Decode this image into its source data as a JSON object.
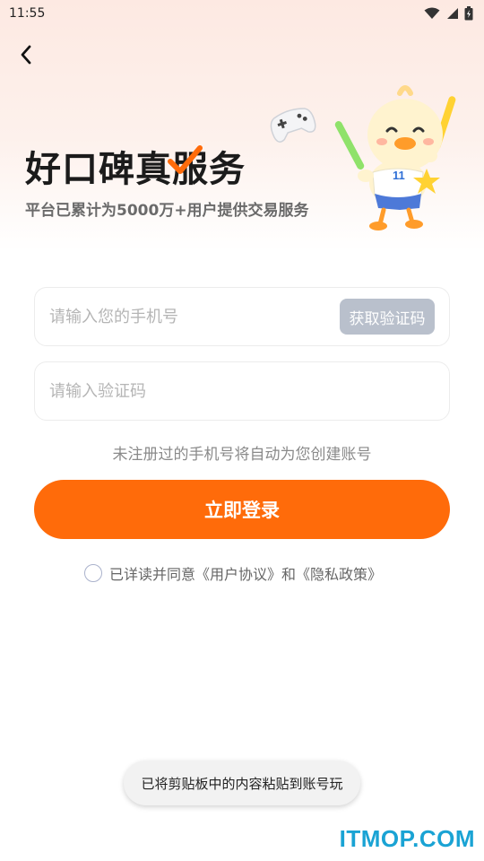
{
  "status_bar": {
    "time": "11:55"
  },
  "hero": {
    "title": "好口碑真服务",
    "subtitle": "平台已累计为5000万+用户提供交易服务",
    "mascot_badge": "11"
  },
  "form": {
    "phone_placeholder": "请输入您的手机号",
    "get_code_label": "获取验证码",
    "code_placeholder": "请输入验证码",
    "hint": "未注册过的手机号将自动为您创建账号",
    "login_label": "立即登录"
  },
  "agreement": {
    "text": "已详读并同意《用户协议》和《隐私政策》"
  },
  "toast": {
    "text": "已将剪贴板中的内容粘贴到账号玩"
  },
  "watermark": {
    "text": "ITMOP.COM"
  },
  "icons": {
    "back": "chevron-left-icon",
    "wifi": "wifi-icon",
    "signal": "signal-icon",
    "battery": "battery-icon"
  },
  "colors": {
    "accent": "#ff6b0a",
    "code_button": "#b9c0cc",
    "watermark": "#1aa3d4"
  }
}
